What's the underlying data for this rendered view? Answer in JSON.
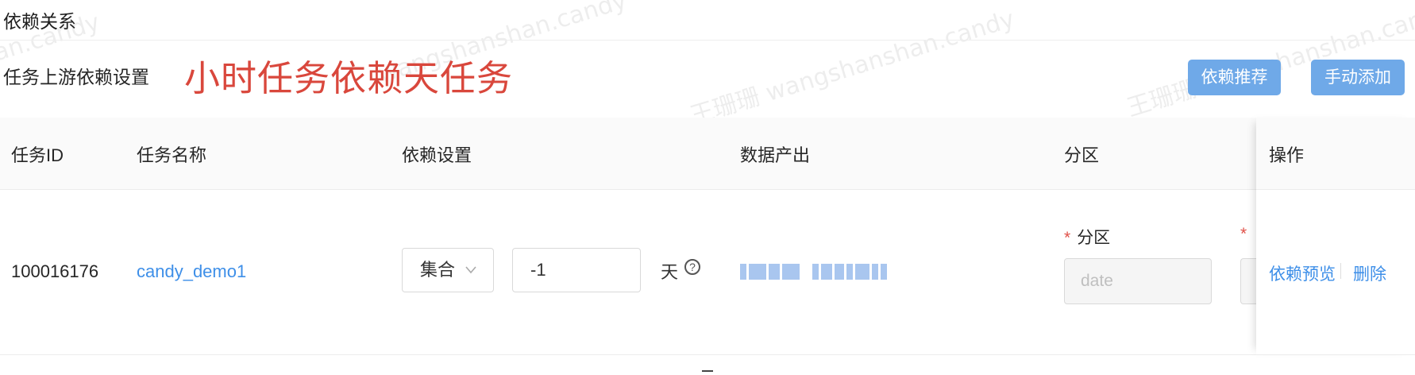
{
  "section": {
    "title": "依赖关系"
  },
  "upstream": {
    "title": "任务上游依赖设置",
    "annotation": "小时任务依赖天任务",
    "recommend_button": "依赖推荐",
    "add_button": "手动添加"
  },
  "table": {
    "columns": [
      "任务ID",
      "任务名称",
      "依赖设置",
      "数据产出",
      "分区",
      "操作"
    ],
    "rows": [
      {
        "task_id": "100016176",
        "task_name": "candy_demo1",
        "dependency_type": "集合",
        "dependency_offset": "-1",
        "dependency_unit": "天",
        "partition_label": "分区",
        "partition_required_mark": "*",
        "partition_value": "date",
        "second_required_mark": "*",
        "actions": {
          "preview": "依赖预览",
          "delete": "删除"
        }
      }
    ]
  },
  "watermarks": [
    "an.candy",
    "wangshanshan.candy",
    "王珊珊 wangshanshan.candy",
    "王珊珊 wangshanshan.candy",
    "王珊珊 wangshanshan.candy"
  ],
  "colors": {
    "accent_button": "#6fa9e8",
    "link": "#3e8fe8",
    "annotation": "#d9473c",
    "required": "#e05149"
  },
  "icons": {
    "help": "question-circle-icon",
    "dropdown": "chevron-down-icon"
  }
}
